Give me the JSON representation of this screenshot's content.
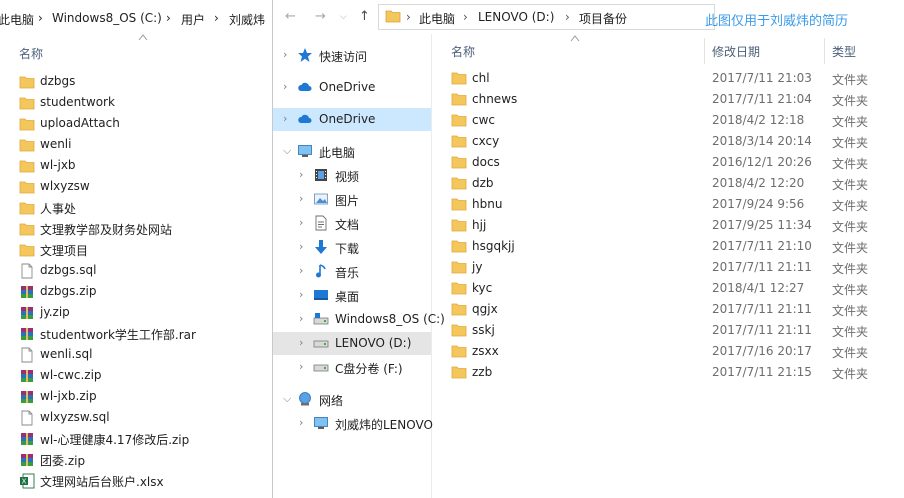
{
  "left_window": {
    "breadcrumb": [
      "此电脑",
      "Windows8_OS (C:)",
      "用户",
      "刘威炜"
    ],
    "column_name": "名称",
    "items": [
      {
        "name": "dzbgs",
        "icon": "folder"
      },
      {
        "name": "studentwork",
        "icon": "folder"
      },
      {
        "name": "uploadAttach",
        "icon": "folder"
      },
      {
        "name": "wenli",
        "icon": "folder"
      },
      {
        "name": "wl-jxb",
        "icon": "folder"
      },
      {
        "name": "wlxyzsw",
        "icon": "folder"
      },
      {
        "name": "人事处",
        "icon": "folder"
      },
      {
        "name": "文理教学部及财务处网站",
        "icon": "folder"
      },
      {
        "name": "文理项目",
        "icon": "folder"
      },
      {
        "name": "dzbgs.sql",
        "icon": "file"
      },
      {
        "name": "dzbgs.zip",
        "icon": "archive"
      },
      {
        "name": "jy.zip",
        "icon": "archive"
      },
      {
        "name": "studentwork学生工作部.rar",
        "icon": "archive"
      },
      {
        "name": "wenli.sql",
        "icon": "file"
      },
      {
        "name": "wl-cwc.zip",
        "icon": "archive"
      },
      {
        "name": "wl-jxb.zip",
        "icon": "archive"
      },
      {
        "name": "wlxyzsw.sql",
        "icon": "file"
      },
      {
        "name": "wl-心理健康4.17修改后.zip",
        "icon": "archive"
      },
      {
        "name": "团委.zip",
        "icon": "archive"
      },
      {
        "name": "文理网站后台账户.xlsx",
        "icon": "excel"
      }
    ]
  },
  "right_window": {
    "breadcrumb": [
      "此电脑",
      "LENOVO (D:)",
      "项目备份"
    ],
    "watermark": "此图仅用于刘威炜的简历",
    "nav": [
      {
        "label": "快速访问",
        "icon": "star",
        "indent": 0
      },
      {
        "label": "OneDrive",
        "icon": "cloud",
        "indent": 0
      },
      {
        "label": "OneDrive",
        "icon": "cloud",
        "indent": 0
      },
      {
        "label": "此电脑",
        "icon": "computer",
        "indent": 0
      },
      {
        "label": "视频",
        "icon": "video",
        "indent": 1
      },
      {
        "label": "图片",
        "icon": "picture",
        "indent": 1
      },
      {
        "label": "文档",
        "icon": "document",
        "indent": 1
      },
      {
        "label": "下载",
        "icon": "download",
        "indent": 1
      },
      {
        "label": "音乐",
        "icon": "music",
        "indent": 1
      },
      {
        "label": "桌面",
        "icon": "desktop",
        "indent": 1
      },
      {
        "label": "Windows8_OS (C:)",
        "icon": "drive-os",
        "indent": 1
      },
      {
        "label": "LENOVO (D:)",
        "icon": "drive",
        "indent": 1
      },
      {
        "label": "C盘分卷 (F:)",
        "icon": "drive",
        "indent": 1
      },
      {
        "label": "网络",
        "icon": "network",
        "indent": 0
      },
      {
        "label": "刘威炜的LENOVO",
        "icon": "computer",
        "indent": 1
      }
    ],
    "columns": {
      "name": "名称",
      "date": "修改日期",
      "type": "类型"
    },
    "rows": [
      {
        "name": "chl",
        "date": "2017/7/11 21:03",
        "type": "文件夹"
      },
      {
        "name": "chnews",
        "date": "2017/7/11 21:04",
        "type": "文件夹"
      },
      {
        "name": "cwc",
        "date": "2018/4/2 12:18",
        "type": "文件夹"
      },
      {
        "name": "cxcy",
        "date": "2018/3/14 20:14",
        "type": "文件夹"
      },
      {
        "name": "docs",
        "date": "2016/12/1 20:26",
        "type": "文件夹"
      },
      {
        "name": "dzb",
        "date": "2018/4/2 12:20",
        "type": "文件夹"
      },
      {
        "name": "hbnu",
        "date": "2017/9/24 9:56",
        "type": "文件夹"
      },
      {
        "name": "hjj",
        "date": "2017/9/25 11:34",
        "type": "文件夹"
      },
      {
        "name": "hsgqkjj",
        "date": "2017/7/11 21:10",
        "type": "文件夹"
      },
      {
        "name": "jy",
        "date": "2017/7/11 21:11",
        "type": "文件夹"
      },
      {
        "name": "kyc",
        "date": "2018/4/1 12:27",
        "type": "文件夹"
      },
      {
        "name": "qgjx",
        "date": "2017/7/11 21:11",
        "type": "文件夹"
      },
      {
        "name": "sskj",
        "date": "2017/7/11 21:11",
        "type": "文件夹"
      },
      {
        "name": "zsxx",
        "date": "2017/7/16 20:17",
        "type": "文件夹"
      },
      {
        "name": "zzb",
        "date": "2017/7/11 21:15",
        "type": "文件夹"
      }
    ]
  },
  "colors": {
    "folder": "#f3c75b",
    "folder_dark": "#e2a93a",
    "selected": "#e5e5e5",
    "hover": "#cce8ff",
    "watermark": "#3c9be8",
    "header_text": "#4c607a"
  }
}
